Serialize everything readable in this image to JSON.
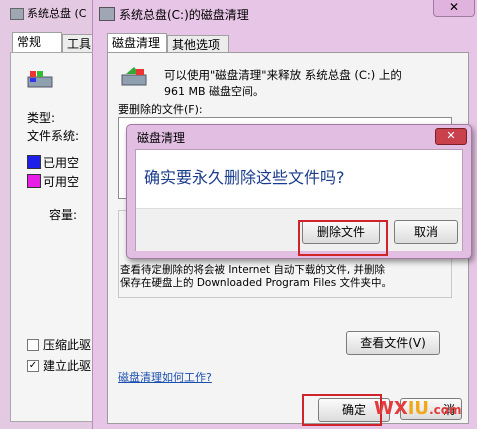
{
  "back_window": {
    "title": "系统总盘 (C",
    "tabs": [
      "常规",
      "工具"
    ],
    "labels": {
      "type": "类型:",
      "fs": "文件系统:",
      "used": "已用空",
      "free": "可用空",
      "capacity": "容量:"
    },
    "used_color": "#1e1eea",
    "free_color": "#e61ee6",
    "checkboxes": [
      {
        "label": "压缩此驱",
        "checked": false
      },
      {
        "label": "建立此驱",
        "checked": true
      }
    ]
  },
  "main_window": {
    "title": "系统总盘(C:)的磁盘清理",
    "tabs": [
      "磁盘清理",
      "其他选项"
    ],
    "intro_line1": "可以使用\"磁盘清理\"来释放 系统总盘 (C:) 上的",
    "intro_line2": "961 MB 磁盘空间。",
    "files_label": "要删除的文件(F):",
    "desc_line1": "查看待定删除的将会被 Internet 自动下载的文件, 并删除",
    "desc_line2": "保存在硬盘上的 Downloaded Program Files 文件夹中。",
    "view_files_button": "查看文件(V)",
    "help_link": "磁盘清理如何工作?",
    "ok_button": "确定",
    "cancel_partial": "消"
  },
  "dialog": {
    "title": "磁盘清理",
    "message": "确实要永久删除这些文件吗?",
    "delete_button": "删除文件",
    "cancel_button": "取消"
  },
  "watermark": {
    "prefix": "WX",
    "brand": "IU",
    "suffix": ".com"
  }
}
